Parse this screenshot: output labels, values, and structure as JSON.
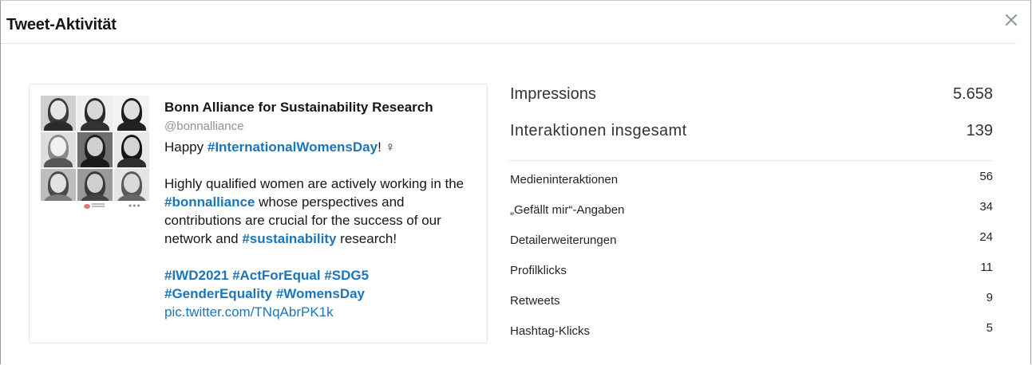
{
  "modal": {
    "title": "Tweet-Aktivität",
    "close_icon": "close-icon"
  },
  "tweet": {
    "author_name": "Bonn Alliance for Sustainability Research",
    "handle": "@bonnalliance",
    "text": {
      "line1_prefix": "Happy ",
      "line1_tag": "#InternationalWomensDay",
      "line1_suffix": "! ♀",
      "p2_a": "Highly qualified women are actively working in the ",
      "p2_tag1": "#bonnalliance",
      "p2_b": " whose perspectives and contributions are crucial for the success of our network and ",
      "p2_tag2": "#sustainability",
      "p2_c": " research!",
      "tag_iwd": "#IWD2021",
      "tag_act": "#ActForEqual",
      "tag_sdg": "#SDG5",
      "tag_gender": "#GenderEquality",
      "tag_womensday": "#WomensDay",
      "link": "pic.twitter.com/TNqAbrPK1k"
    },
    "media_icon": "photo-collage-image"
  },
  "stats": {
    "impressions_label": "Impressions",
    "impressions_value": "5.658",
    "interactions_label": "Interaktionen insgesamt",
    "interactions_value": "139",
    "breakdown": [
      {
        "label": "Medieninteraktionen",
        "value": "56"
      },
      {
        "label": "„Gefällt mir“-Angaben",
        "value": "34"
      },
      {
        "label": "Detailerweiterungen",
        "value": "24"
      },
      {
        "label": "Profilklicks",
        "value": "11"
      },
      {
        "label": "Retweets",
        "value": "9"
      },
      {
        "label": "Hashtag-Klicks",
        "value": "5"
      }
    ]
  },
  "colors": {
    "link_blue": "#1b75bb",
    "handle_gray": "#8a959e",
    "divider": "#e1e8ed"
  }
}
